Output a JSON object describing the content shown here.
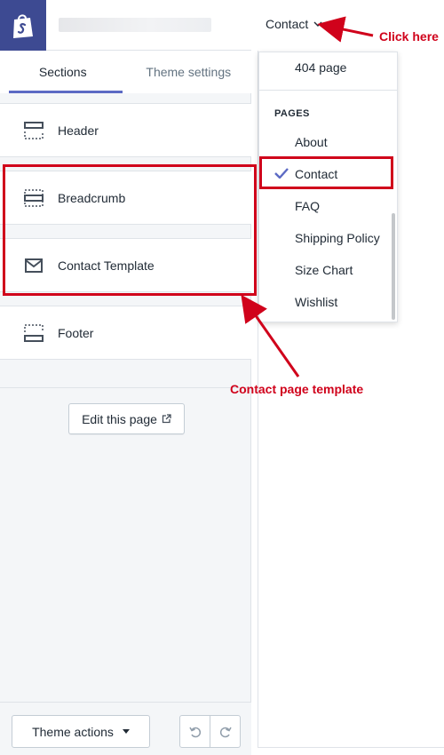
{
  "tabs": {
    "sections": "Sections",
    "theme_settings": "Theme settings"
  },
  "sections": [
    {
      "label": "Header",
      "icon": "header-layout-icon"
    },
    {
      "label": "Breadcrumb",
      "icon": "breadcrumb-layout-icon"
    },
    {
      "label": "Contact Template",
      "icon": "envelope-icon"
    },
    {
      "label": "Footer",
      "icon": "footer-layout-icon"
    }
  ],
  "edit_page_label": "Edit this page",
  "theme_actions_label": "Theme actions",
  "page_selector": {
    "current": "Contact"
  },
  "dropdown": {
    "top_item": "404 page",
    "heading": "PAGES",
    "pages": [
      "About",
      "Contact",
      "FAQ",
      "Shipping Policy",
      "Size Chart",
      "Wishlist"
    ],
    "selected": "Contact"
  },
  "annotations": {
    "click_here": "Click here",
    "contact_page_template": "Contact page template"
  },
  "colors": {
    "accent": "#5c6ac4",
    "logo_bg": "#3d4a92",
    "annotation": "#d0021b"
  }
}
